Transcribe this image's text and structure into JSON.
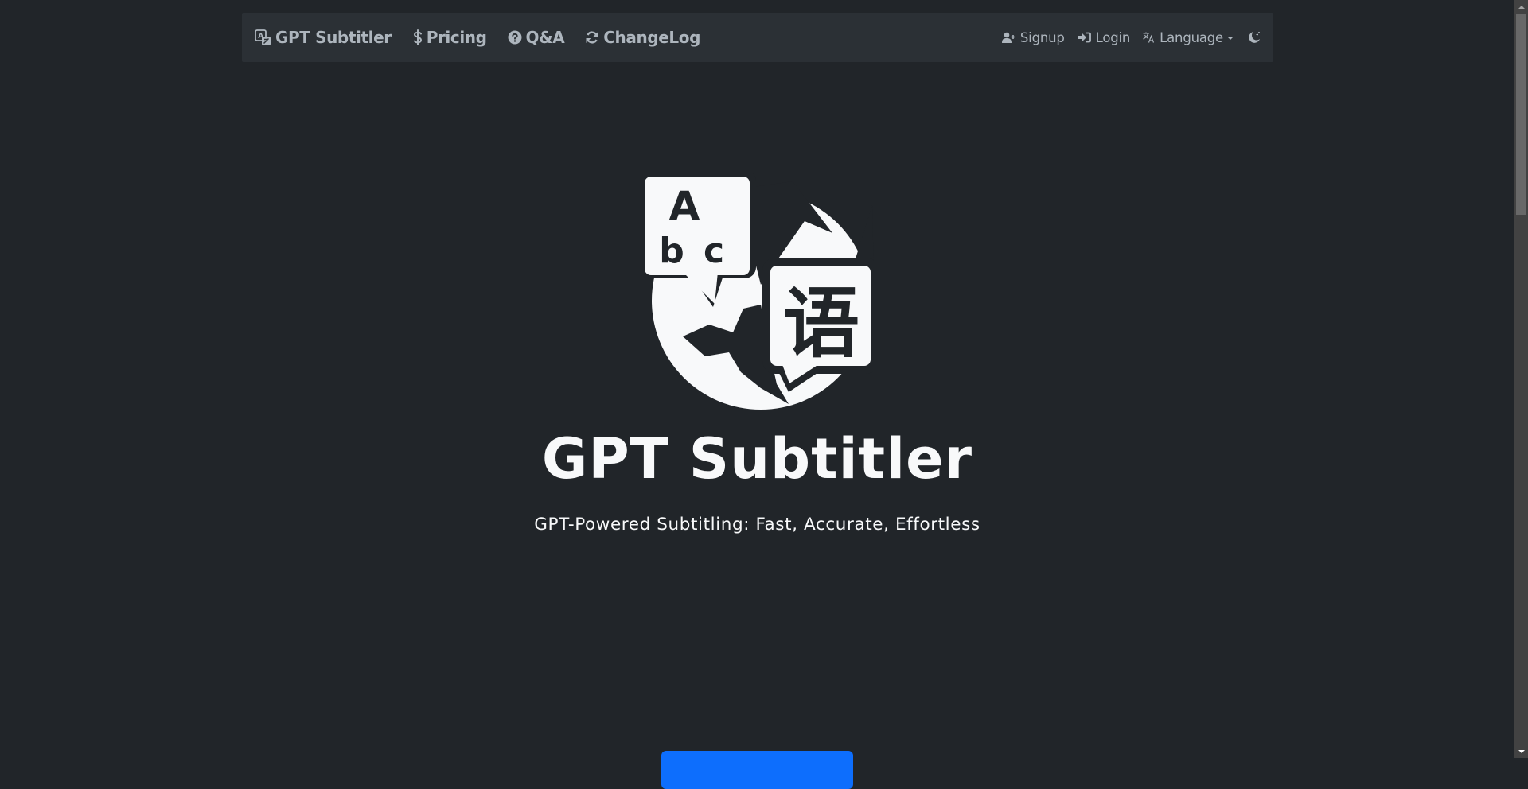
{
  "navbar": {
    "brand": {
      "label": "GPT Subtitler",
      "icon": "translate-box-icon"
    },
    "left_items": [
      {
        "label": "Pricing",
        "icon": "dollar-icon"
      },
      {
        "label": "Q&A",
        "icon": "question-circle-icon"
      },
      {
        "label": "ChangeLog",
        "icon": "refresh-icon"
      }
    ],
    "right_items": [
      {
        "label": "Signup",
        "icon": "user-plus-icon"
      },
      {
        "label": "Login",
        "icon": "sign-in-icon"
      },
      {
        "label": "Language",
        "icon": "translate-icon",
        "dropdown": true
      }
    ],
    "theme_toggle_icon": "moon-stars-icon"
  },
  "hero": {
    "logo": "globe-translation-logo",
    "logo_glyphs": {
      "bubble_left": [
        "A",
        "b",
        "c"
      ],
      "bubble_right": "语"
    },
    "title": "GPT Subtitler",
    "subtitle": "GPT-Powered Subtitling: Fast, Accurate, Effortless"
  },
  "cta": {
    "label": ""
  },
  "colors": {
    "background": "#212529",
    "navbar": "#2b3035",
    "nav_text": "#adb5bd",
    "hero_text": "#f8f9fa",
    "primary": "#0d6efd"
  }
}
